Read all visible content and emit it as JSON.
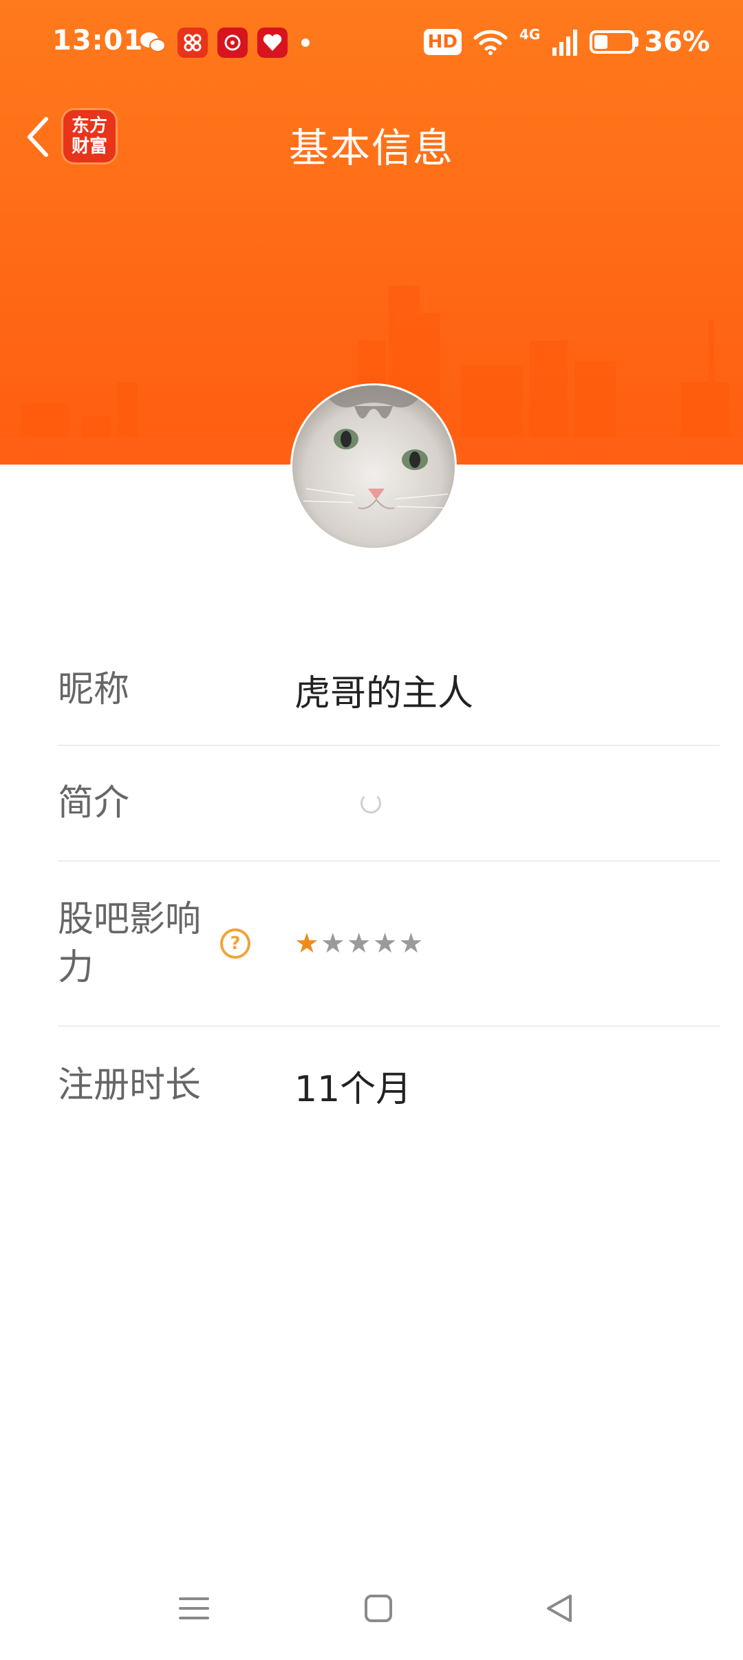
{
  "status_bar": {
    "time": "13:01",
    "hd_badge": "HD",
    "network": "4G",
    "battery_level": 0.36,
    "battery_text": "36%"
  },
  "nav": {
    "title": "基本信息",
    "logo_line1": "东方",
    "logo_line2": "财富"
  },
  "colors": {
    "header_orange": "#ff6a16",
    "star_active": "#f08a1c",
    "help_icon": "#f0a33a"
  },
  "profile": {
    "fields": [
      {
        "label": "昵称",
        "value": "虎哥的主人"
      },
      {
        "label": "简介",
        "value": ""
      },
      {
        "label": "股吧影响力",
        "rating": 1,
        "rating_max": 5
      },
      {
        "label": "注册时长",
        "value": "11个月"
      }
    ]
  },
  "icons": {
    "back": "chevron-left-icon",
    "help": "question-circle-icon",
    "loading": "loading-spinner-icon",
    "sys_menu": "menu-icon",
    "sys_home": "square-home-icon",
    "sys_back": "triangle-back-icon"
  }
}
